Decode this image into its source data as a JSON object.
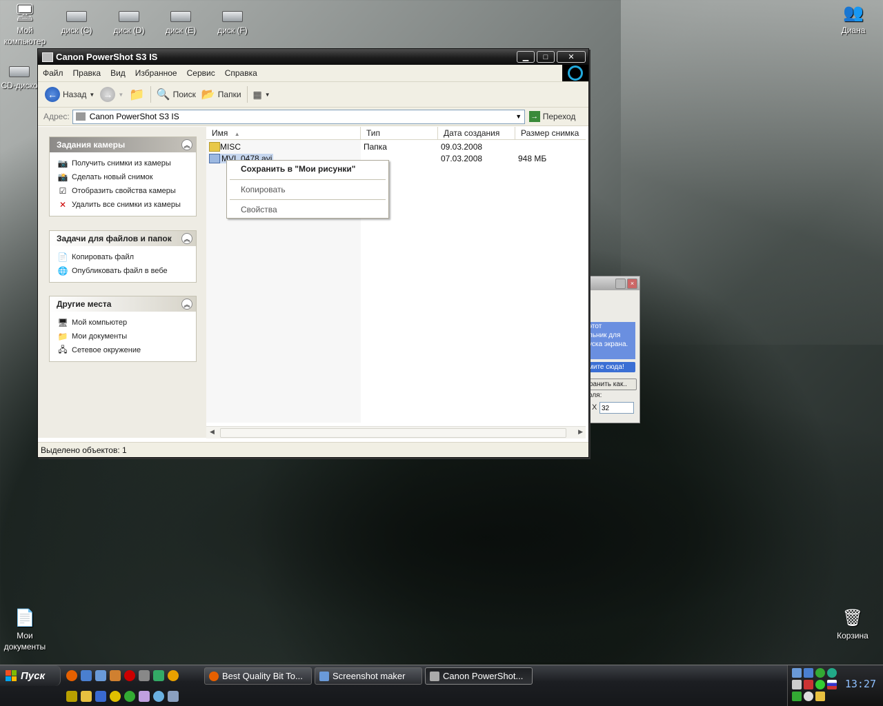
{
  "desktop": {
    "icons_top": [
      {
        "label": "Мой компьютер"
      },
      {
        "label": "диск (C)"
      },
      {
        "label": "диск (D)"
      },
      {
        "label": "диск (E)"
      },
      {
        "label": "диск (F)"
      }
    ],
    "cd_icon": {
      "label": "CD-диско"
    },
    "user_icon": {
      "label": "Диана"
    },
    "my_docs_icon": {
      "label": "Мои документы"
    },
    "recycle_icon": {
      "label": "Корзина"
    }
  },
  "window": {
    "title": "Canon PowerShot S3 IS",
    "menu": [
      "Файл",
      "Правка",
      "Вид",
      "Избранное",
      "Сервис",
      "Справка"
    ],
    "toolbar": {
      "back_label": "Назад",
      "search_label": "Поиск",
      "folders_label": "Папки"
    },
    "address": {
      "label": "Адрес:",
      "value": "Canon PowerShot S3 IS",
      "go_label": "Переход"
    },
    "panels": {
      "camera": {
        "title": "Задания камеры",
        "items": [
          "Получить снимки из камеры",
          "Сделать новый снимок",
          "Отобразить свойства камеры",
          "Удалить все снимки из камеры"
        ]
      },
      "files": {
        "title": "Задачи для файлов и папок",
        "items": [
          "Копировать файл",
          "Опубликовать файл в вебе"
        ]
      },
      "places": {
        "title": "Другие места",
        "items": [
          "Мой компьютер",
          "Мои документы",
          "Сетевое окружение"
        ]
      }
    },
    "columns": [
      "Имя",
      "Тип",
      "Дата создания",
      "Размер снимка"
    ],
    "rows": [
      {
        "name": "MISC",
        "type": "Папка",
        "date": "09.03.2008",
        "size": ""
      },
      {
        "name": "MVI_0478.avi",
        "type": "",
        "date": "07.03.2008",
        "size": "948 МБ"
      }
    ],
    "status": "Выделено объектов: 1"
  },
  "context_menu": {
    "items": [
      "Сохранить в \"Мои рисунки\"",
      "Копировать",
      "Свойства"
    ]
  },
  "side_dialog": {
    "info_text": "этот\nльник для\nуска экрана.",
    "button1": "мите сюда!",
    "button2": "ранить как..",
    "label": "оля:",
    "x": "X",
    "value": "32"
  },
  "taskbar": {
    "start_label": "Пуск",
    "buttons": [
      "Best Quality Bit To...",
      "Screenshot maker",
      "Canon PowerShot..."
    ],
    "clock": "13:27"
  },
  "colors": {
    "taskbar": "#1c1e22",
    "panel_bg": "#eeece4",
    "accent_blue": "#3b6fd4"
  }
}
